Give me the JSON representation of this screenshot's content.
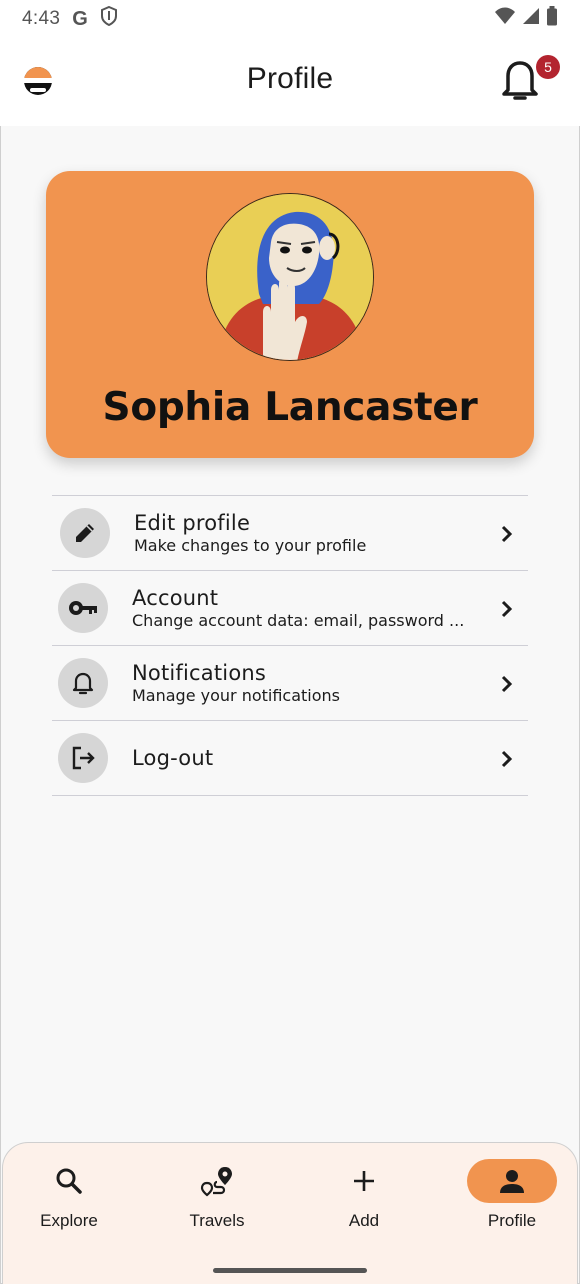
{
  "status_bar": {
    "time": "4:43",
    "g_label": "G",
    "left_icons": [
      "google-icon",
      "shield-icon"
    ],
    "right_icons": [
      "wifi-icon",
      "signal-icon",
      "battery-icon"
    ]
  },
  "app_bar": {
    "title": "Profile",
    "notification_count": "5",
    "logo_icon": "app-logo-icon",
    "bell_icon": "bell-icon"
  },
  "profile": {
    "name": "Sophia Lancaster",
    "card_color": "#f1944f"
  },
  "menu": {
    "items": [
      {
        "title": "Edit profile",
        "subtitle": "Make changes to your profile",
        "icon": "pencil-icon"
      },
      {
        "title": "Account",
        "subtitle": "Change account data: email, password ...",
        "icon": "key-icon"
      },
      {
        "title": "Notifications",
        "subtitle": "Manage your notifications",
        "icon": "bell-icon"
      },
      {
        "title": "Log-out",
        "subtitle": "",
        "icon": "logout-icon"
      }
    ]
  },
  "bottom_nav": {
    "items": [
      {
        "label": "Explore",
        "icon": "search-icon",
        "active": false
      },
      {
        "label": "Travels",
        "icon": "route-icon",
        "active": false
      },
      {
        "label": "Add",
        "icon": "plus-icon",
        "active": false
      },
      {
        "label": "Profile",
        "icon": "person-icon",
        "active": true
      }
    ],
    "active_color": "#f1944f",
    "background": "#fdf1ea"
  }
}
